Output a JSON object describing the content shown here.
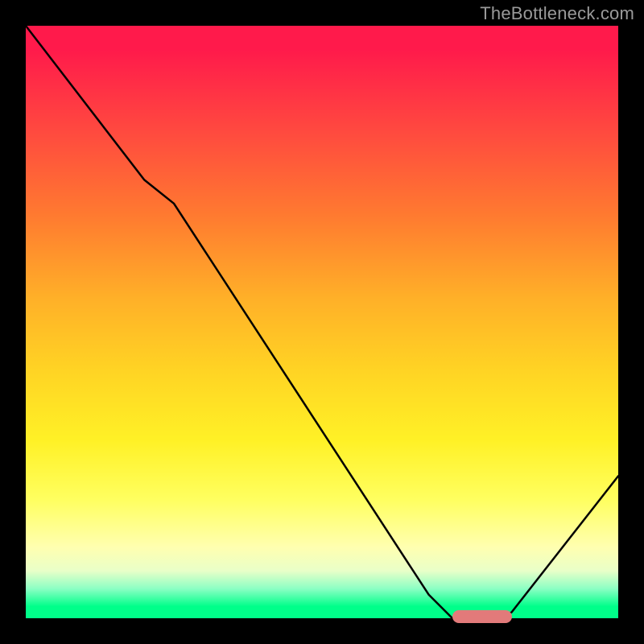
{
  "watermark": "TheBottleneck.com",
  "colors": {
    "background": "#000000",
    "curve": "#000000",
    "marker": "#e27a7a",
    "gradient_top": "#ff1a4b",
    "gradient_mid": "#ffd324",
    "gradient_bottom": "#00ff8a"
  },
  "chart_data": {
    "type": "line",
    "title": "",
    "xlabel": "",
    "ylabel": "",
    "xlim": [
      0,
      100
    ],
    "ylim": [
      0,
      100
    ],
    "grid": false,
    "legend": false,
    "series": [
      {
        "name": "bottleneck-curve",
        "x": [
          0,
          20,
          25,
          68,
          72,
          80,
          82,
          100
        ],
        "values": [
          100,
          74,
          70,
          4,
          0,
          0,
          1,
          24
        ]
      }
    ],
    "marker": {
      "name": "optimal-range",
      "x_start": 72,
      "x_end": 82,
      "y": 0
    }
  }
}
